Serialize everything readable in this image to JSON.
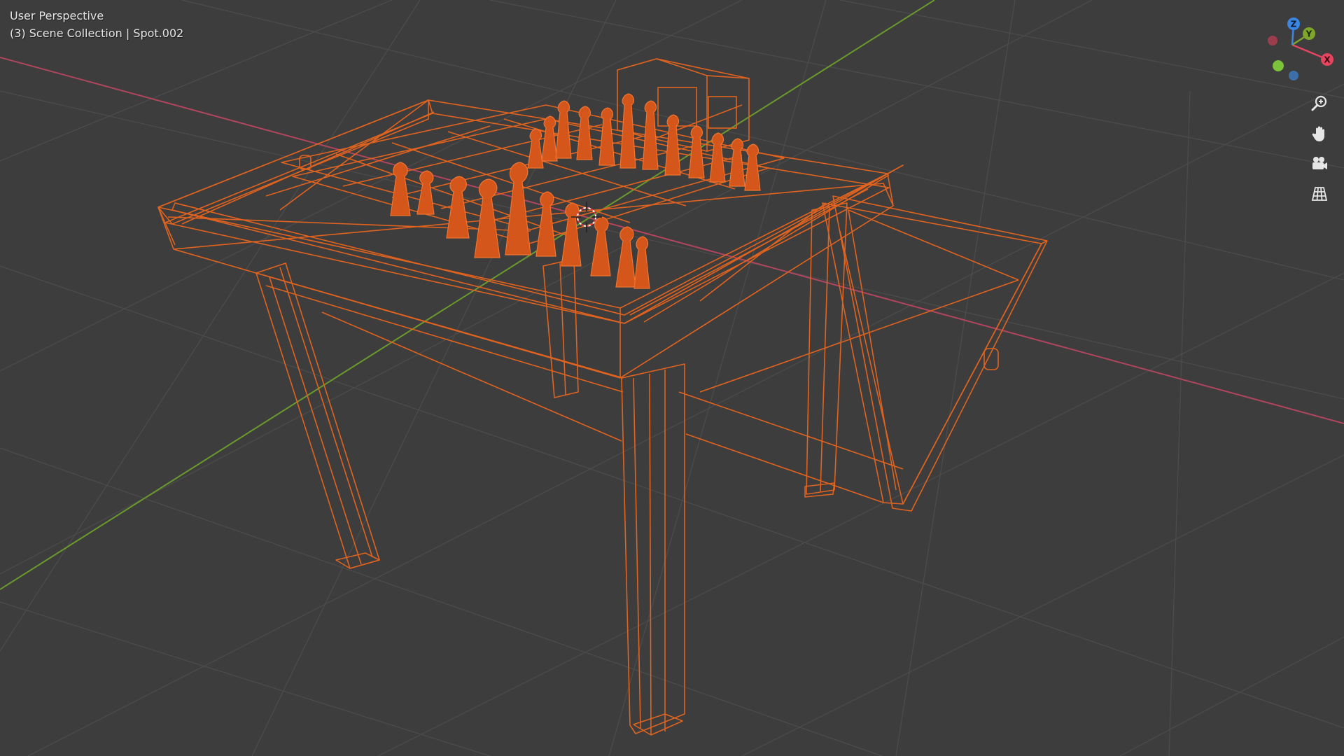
{
  "viewport": {
    "view_name": "User Perspective",
    "context": "(3) Scene Collection | Spot.002"
  },
  "colors": {
    "background": "#3d3d3d",
    "grid_line": "#4a4a4a",
    "x_axis": "#b0455e",
    "y_axis": "#6b9a2c",
    "selection_wire": "#e0631f",
    "gizmo_x": "#e5455f",
    "gizmo_y": "#7ea62a",
    "gizmo_z": "#3b86e3",
    "gizmo_neg_x": "#9c3d4d",
    "gizmo_neg_y": "#7cc23a",
    "gizmo_neg_z": "#3c6fa8"
  },
  "gizmo": {
    "x_label": "X",
    "y_label": "Y",
    "z_label": "Z"
  },
  "navigation": {
    "zoom_icon": "zoom-icon",
    "pan_icon": "hand-icon",
    "camera_icon": "camera-icon",
    "ortho_icon": "grid-perspective-icon"
  }
}
